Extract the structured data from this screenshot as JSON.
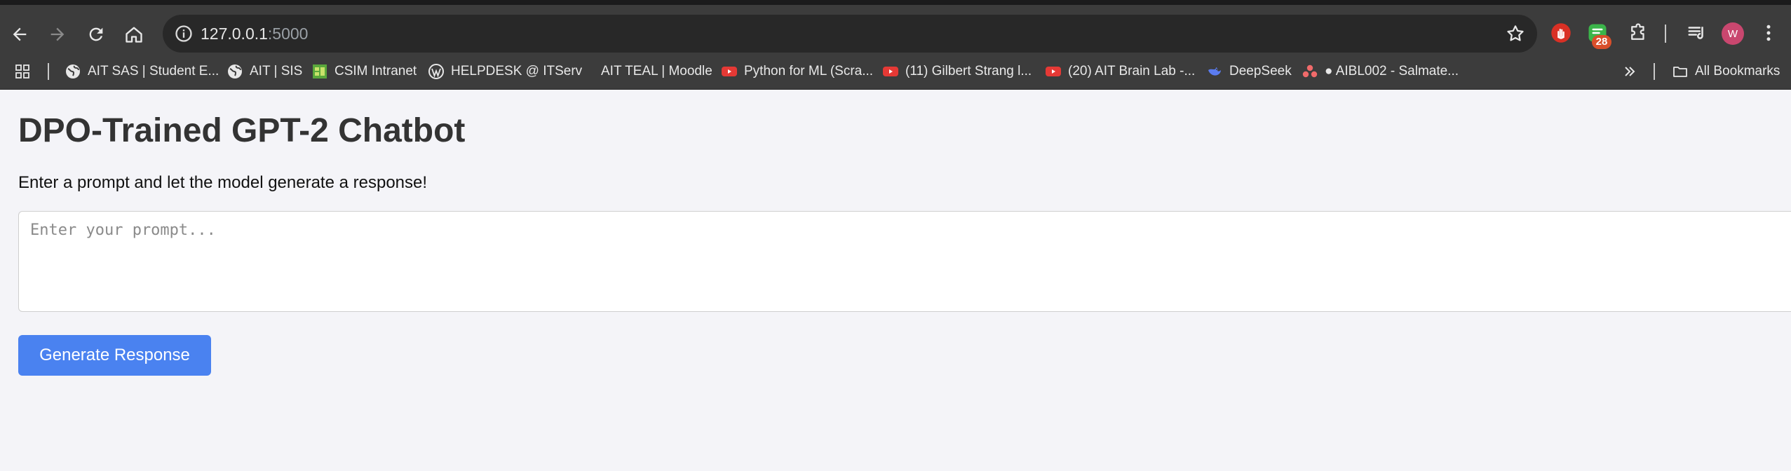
{
  "browser": {
    "url_host": "127.0.0.1",
    "url_port": ":5000",
    "extension_badge": "28",
    "avatar_initial": "W"
  },
  "bookmarks": {
    "items": [
      {
        "label": "AIT SAS | Student E...",
        "icon": "globe-icon"
      },
      {
        "label": "AIT | SIS",
        "icon": "globe-icon"
      },
      {
        "label": "CSIM Intranet",
        "icon": "csim-icon"
      },
      {
        "label": "HELPDESK @ ITServ",
        "icon": "wordpress-icon"
      },
      {
        "label": "AIT TEAL | Moodle",
        "icon": ""
      },
      {
        "label": "Python for ML (Scra...",
        "icon": "youtube-icon"
      },
      {
        "label": "(11) Gilbert Strang l...",
        "icon": "youtube-icon"
      },
      {
        "label": "(20) AIT Brain Lab -...",
        "icon": "youtube-icon"
      },
      {
        "label": "DeepSeek",
        "icon": "deepseek-icon"
      },
      {
        "label": "● AIBL002 - Salmate...",
        "icon": "asana-icon"
      }
    ],
    "all_bookmarks": "All Bookmarks"
  },
  "page": {
    "title": "DPO-Trained GPT-2 Chatbot",
    "subtitle": "Enter a prompt and let the model generate a response!",
    "prompt_placeholder": "Enter your prompt...",
    "prompt_value": "",
    "button_label": "Generate Response"
  },
  "colors": {
    "accent_button": "#4a82f0",
    "page_background": "#f4f4f8",
    "chrome_background": "#3c3c3c"
  }
}
